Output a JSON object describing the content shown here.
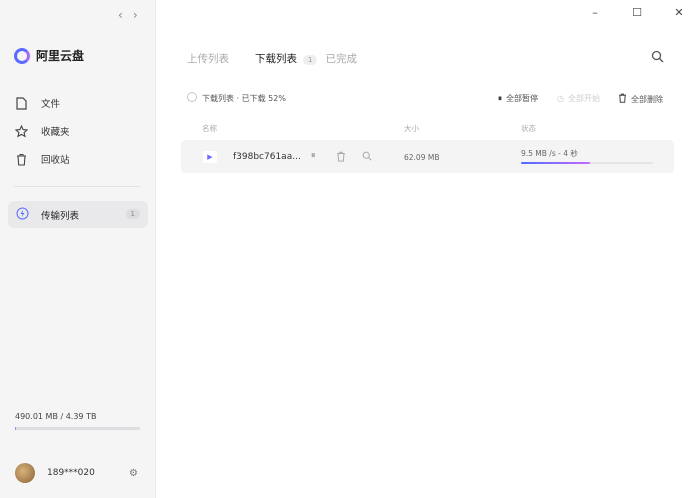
{
  "sidebar": {
    "brand": "阿里云盘",
    "items": [
      {
        "label": "文件",
        "icon": "file-icon"
      },
      {
        "label": "收藏夹",
        "icon": "star-icon"
      },
      {
        "label": "回收站",
        "icon": "trash-icon"
      }
    ],
    "transfer": {
      "label": "传输列表",
      "badge": "1",
      "icon": "lightning-icon"
    },
    "storage": {
      "text": "490.01 MB / 4.39 TB",
      "used_fraction": 0.0001
    },
    "user": {
      "name": "189***020"
    }
  },
  "main": {
    "tabs": [
      {
        "label": "上传列表",
        "active": false
      },
      {
        "label": "下载列表",
        "active": true,
        "count": "1"
      },
      {
        "label": "已完成",
        "active": false
      }
    ],
    "toolbar": {
      "select_text": "下载列表 · 已下载 52%",
      "pause_all": "全部暂停",
      "start_all": "全部开始",
      "delete_all": "全部删除"
    },
    "columns": {
      "name": "名称",
      "size": "大小",
      "status": "状态"
    },
    "rows": [
      {
        "name": "f398bc761aa...",
        "size": "62.09 MB",
        "status": "9.5 MB /s - 4 秒",
        "progress": 0.52
      }
    ]
  },
  "colors": {
    "accent": "#5b6bff",
    "progress_end": "#c66bff"
  }
}
